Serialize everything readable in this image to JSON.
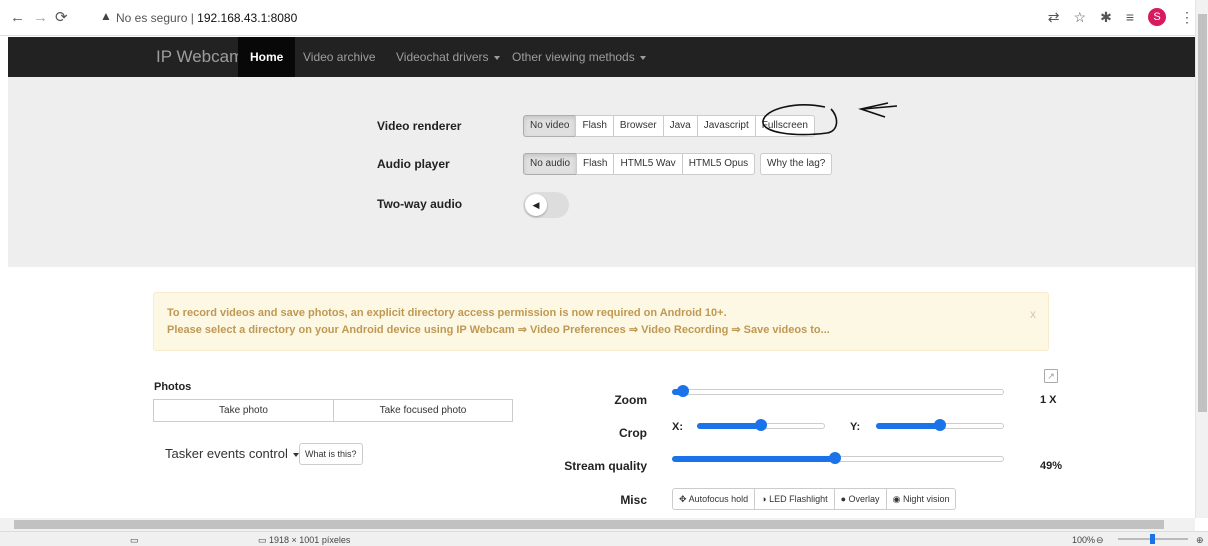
{
  "browser": {
    "url_warning": "No es seguro",
    "url": "192.168.43.1:8080",
    "profile_initial": "S"
  },
  "navbar": {
    "brand": "IP Webcam",
    "items": [
      {
        "label": "Home"
      },
      {
        "label": "Video archive"
      },
      {
        "label": "Videochat drivers"
      },
      {
        "label": "Other viewing methods"
      }
    ]
  },
  "settings": {
    "video_renderer": {
      "label": "Video renderer",
      "options": [
        "No video",
        "Flash",
        "Browser",
        "Java",
        "Javascript",
        "Fullscreen"
      ],
      "selected": "No video"
    },
    "audio_player": {
      "label": "Audio player",
      "options": [
        "No audio",
        "Flash",
        "HTML5 Wav",
        "HTML5 Opus"
      ],
      "selected": "No audio",
      "help_button": "Why the lag?"
    },
    "two_way_audio": {
      "label": "Two-way audio",
      "enabled": false
    }
  },
  "alert": {
    "line1": "To record videos and save photos, an explicit directory access permission is now required on Android 10+.",
    "line2": "Please select a directory on your Android device using IP Webcam ⇒ Video Preferences ⇒ Video Recording ⇒ Save videos to...",
    "close": "x"
  },
  "photos": {
    "title": "Photos",
    "take_photo": "Take photo",
    "take_focused_photo": "Take focused photo"
  },
  "tasker": {
    "label": "Tasker events control",
    "help_button": "What is this?"
  },
  "controls": {
    "zoom": {
      "label": "Zoom",
      "value_text": "1 X",
      "level": 0.03
    },
    "crop": {
      "label": "Crop",
      "x_label": "X:",
      "y_label": "Y:",
      "x_level": 0.5,
      "y_level": 0.5
    },
    "stream_quality": {
      "label": "Stream quality",
      "value_text": "49%",
      "level": 0.49
    },
    "misc": {
      "label": "Misc",
      "buttons": [
        "Autofocus hold",
        "LED Flashlight",
        "Overlay",
        "Night vision"
      ]
    }
  },
  "statusbar": {
    "dimensions": "1918 × 1001 píxeles",
    "zoom": "100%"
  },
  "colors": {
    "accent": "#1a73e8",
    "navbar_bg": "#222222",
    "alert_bg": "#fcf8e3",
    "alert_text": "#c09853"
  }
}
